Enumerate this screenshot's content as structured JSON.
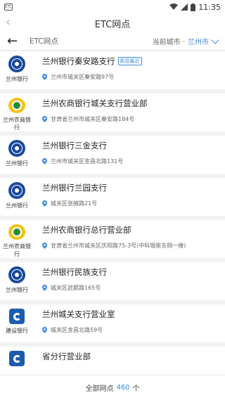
{
  "status_bar": {
    "time": "11:35",
    "app_label": "ETC"
  },
  "nav": {
    "title": "ETC网点"
  },
  "sub_header": {
    "title": "ETC网点",
    "city_prefix": "当前城市 ·",
    "city": "兰州市"
  },
  "branches": [
    {
      "logo": "lanzhou",
      "bank_label": "兰州银行",
      "name": "兰州银行秦安路支行",
      "badge": "距您最近",
      "address": "兰州市城关区秦安路97号"
    },
    {
      "logo": "nongshang",
      "bank_label": "兰州农商银行",
      "name": "兰州农商银行城关支行营业部",
      "badge": "",
      "address": "甘肃省兰州市城关区秦安路184号"
    },
    {
      "logo": "lanzhou",
      "bank_label": "兰州银行",
      "name": "兰州银行三金支行",
      "badge": "",
      "address": "兰州市城关区金昌北路131号"
    },
    {
      "logo": "lanzhou",
      "bank_label": "兰州银行",
      "name": "兰州银行兰园支行",
      "badge": "",
      "address": "城关区张掖路21号"
    },
    {
      "logo": "nongshang",
      "bank_label": "兰州农商银行",
      "name": "兰州农商银行总行营业部",
      "badge": "",
      "address": "甘肃省兰州市城关区庆阳路75-3号(中科银座东侧一楼)"
    },
    {
      "logo": "lanzhou",
      "bank_label": "兰州银行",
      "name": "兰州银行民族支行",
      "badge": "",
      "address": "城关区武都路165号"
    },
    {
      "logo": "jianshe",
      "bank_label": "建设银行",
      "name": "兰州城关支行营业室",
      "badge": "",
      "address": "城关区金昌北路59号"
    },
    {
      "logo": "jianshe",
      "bank_label": "",
      "name": "省分行营业部",
      "badge": "",
      "address": ""
    }
  ],
  "footer": {
    "prefix": "全部网点",
    "count": "460",
    "suffix": "个"
  },
  "colors": {
    "accent": "#3d8de0"
  }
}
